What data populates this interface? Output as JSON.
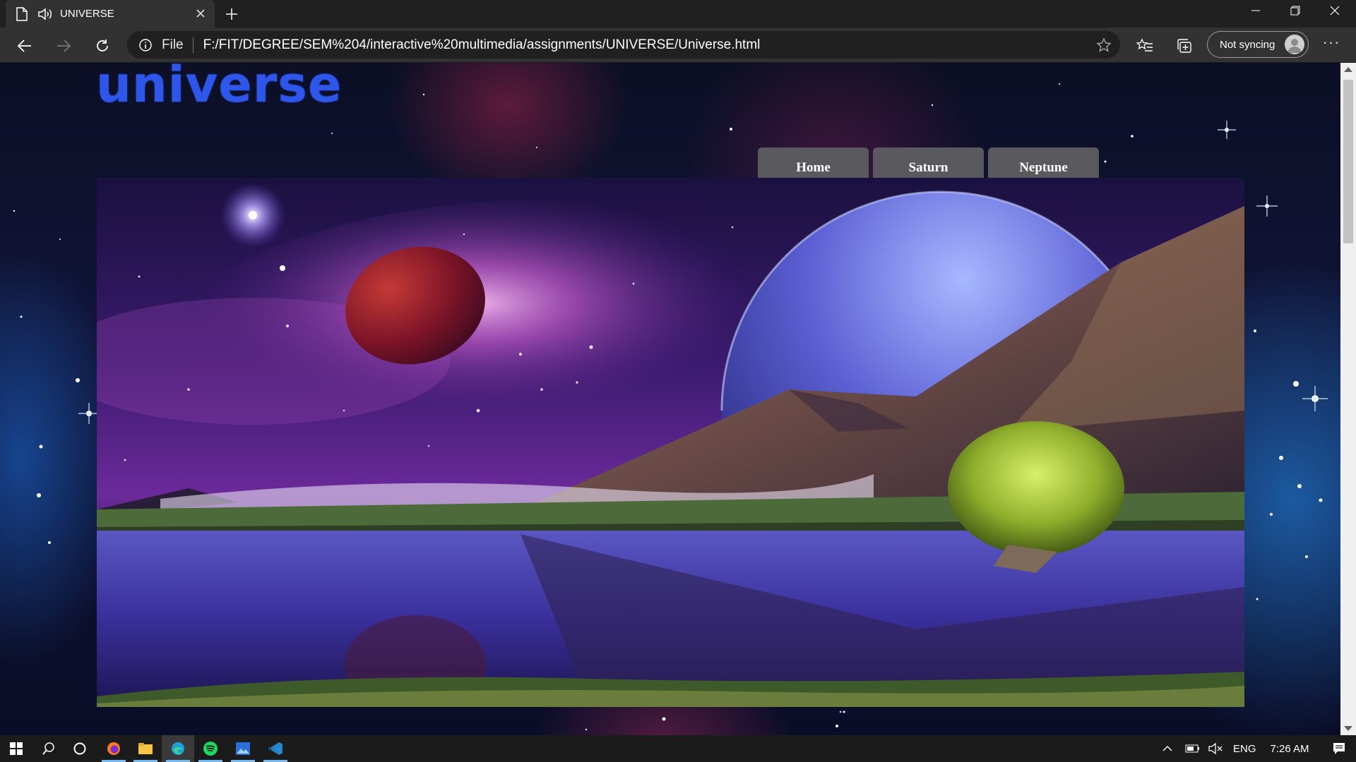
{
  "browser": {
    "tab": {
      "title": "UNIVERSE",
      "icon": "document-icon",
      "audio_icon": "speaker-icon"
    },
    "new_tab_icon": "plus-icon",
    "window_controls": [
      "minimize-icon",
      "restore-icon",
      "close-icon"
    ],
    "address": {
      "scheme": "File",
      "url": "F:/FIT/DEGREE/SEM%204/interactive%20multimedia/assignments/UNIVERSE/Universe.html"
    },
    "profile": {
      "label": "Not syncing"
    }
  },
  "page": {
    "logo": "universe",
    "nav": [
      {
        "label": "Home"
      },
      {
        "label": "Saturn"
      },
      {
        "label": "Neptune"
      }
    ]
  },
  "taskbar": {
    "apps": [
      "windows-start-icon",
      "search-icon",
      "cortana-icon",
      "firefox-icon",
      "file-explorer-icon",
      "edge-icon",
      "spotify-icon",
      "photos-icon",
      "vscode-icon"
    ],
    "tray": {
      "language": "ENG",
      "time": "7:26 AM"
    }
  },
  "colors": {
    "logo": "#2e56e8",
    "nav_button": "#5a5a5e",
    "chrome_dark": "#202020",
    "toolbar": "#323232"
  }
}
